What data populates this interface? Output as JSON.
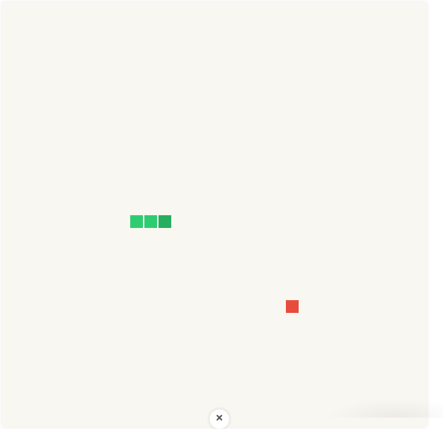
{
  "game": {
    "name": "snake",
    "grid_cell_count": 30,
    "snake": {
      "length": 3,
      "direction": "right",
      "segments": [
        {
          "col": 9,
          "row": 15,
          "role": "body"
        },
        {
          "col": 10,
          "row": 15,
          "role": "body"
        },
        {
          "col": 11,
          "row": 15,
          "role": "head"
        }
      ]
    },
    "food": {
      "col": 20,
      "row": 21
    }
  },
  "colors": {
    "board_background": "#f9f7f1",
    "snake_body": "#2ecc71",
    "snake_head": "#27ae60",
    "food": "#e74c3c"
  },
  "icons": {
    "close": "close-icon"
  }
}
